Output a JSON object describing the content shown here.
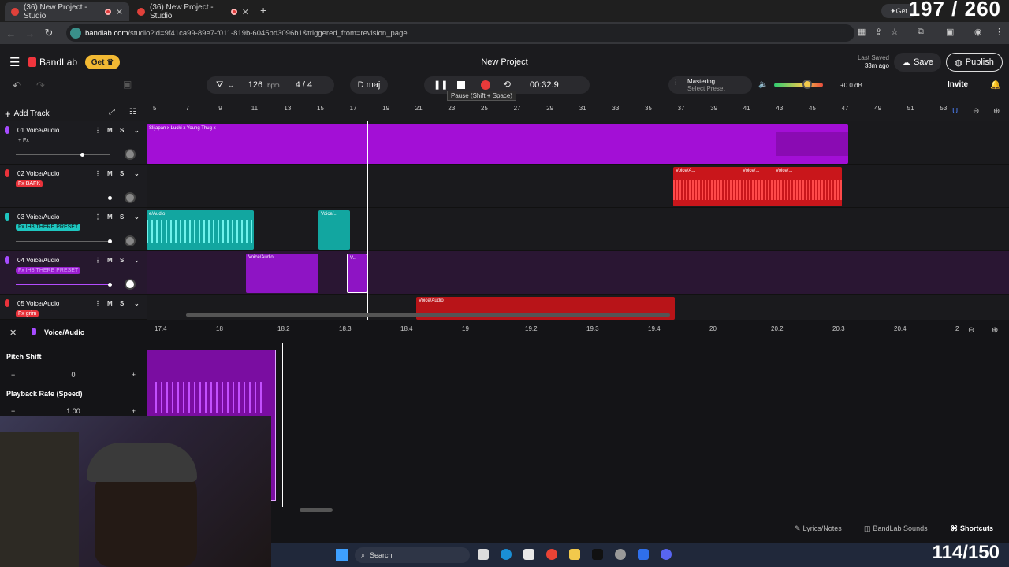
{
  "browser": {
    "tabs": [
      {
        "title": "(36) New Project - Studio",
        "recording": true
      },
      {
        "title": "(36) New Project - Studio",
        "recording": true
      }
    ],
    "url_prefix": "bandlab.com",
    "url_rest": "/studio?id=9f41ca99-89e7-f011-819b-6045bd3096b1&triggered_from=revision_page",
    "overlay_counter": "197 / 260",
    "get_label": "Get"
  },
  "app": {
    "logo": "BandLab",
    "get_button": "Get",
    "project_title": "New Project",
    "last_saved_label": "Last Saved",
    "last_saved_time": "33m ago",
    "save": "Save",
    "publish": "Publish",
    "tempo": "126",
    "tempo_unit": "bpm",
    "time_signature": "4 / 4",
    "key": "D maj",
    "time_display": "00:32.9",
    "tooltip": "Pause (Shift + Space)",
    "mastering_title": "Mastering",
    "mastering_sub": "Select Preset",
    "volume_db": "+0.0 dB",
    "volume_level": 0.7,
    "invite": "Invite",
    "add_track": "Add Track"
  },
  "ruler": [
    "5",
    "7",
    "9",
    "11",
    "13",
    "15",
    "17",
    "19",
    "21",
    "23",
    "25",
    "27",
    "29",
    "31",
    "33",
    "35",
    "37",
    "39",
    "41",
    "43",
    "45",
    "47",
    "49",
    "51",
    "53"
  ],
  "tracks": [
    {
      "name": "01  Voice/Audio",
      "fx": "+ Fx",
      "fx_style": "plain"
    },
    {
      "name": "02  Voice/Audio",
      "fx": "Fx BAFK",
      "fx_style": "red"
    },
    {
      "name": "03  Voice/Audio",
      "fx": "Fx IH8ITHERE PRESET",
      "fx_style": "teal"
    },
    {
      "name": "04  Voice/Audio",
      "fx": "Fx IH8ITHERE PRESET",
      "fx_style": "purple"
    },
    {
      "name": "05  Voice/Audio",
      "fx": "Fx grim",
      "fx_style": "red"
    }
  ],
  "clips": {
    "c1": "Slijapan x Lucki x Young Thug x",
    "c2a": "Voice/A...",
    "c2b": "Voice/...",
    "c2c": "Voice/...",
    "c3a": "e/Audio",
    "c3b": "Voice/...",
    "c4a": "Voice/Audio",
    "c4b": "V...",
    "c5": "Voice/Audio"
  },
  "editor": {
    "track_label": "Voice/Audio",
    "pitch_label": "Pitch Shift",
    "pitch_value": "0",
    "rate_label": "Playback Rate (Speed)",
    "rate_value": "1.00",
    "ruler": [
      "17.4",
      "18",
      "18.2",
      "18.3",
      "18.4",
      "19",
      "19.2",
      "19.3",
      "19.4",
      "20",
      "20.2",
      "20.3",
      "20.4",
      "2"
    ]
  },
  "bottom": {
    "lyrics": "Lyrics/Notes",
    "sounds": "BandLab Sounds",
    "shortcuts": "Shortcuts"
  },
  "taskbar": {
    "search": "Search",
    "counter": "114/150"
  }
}
